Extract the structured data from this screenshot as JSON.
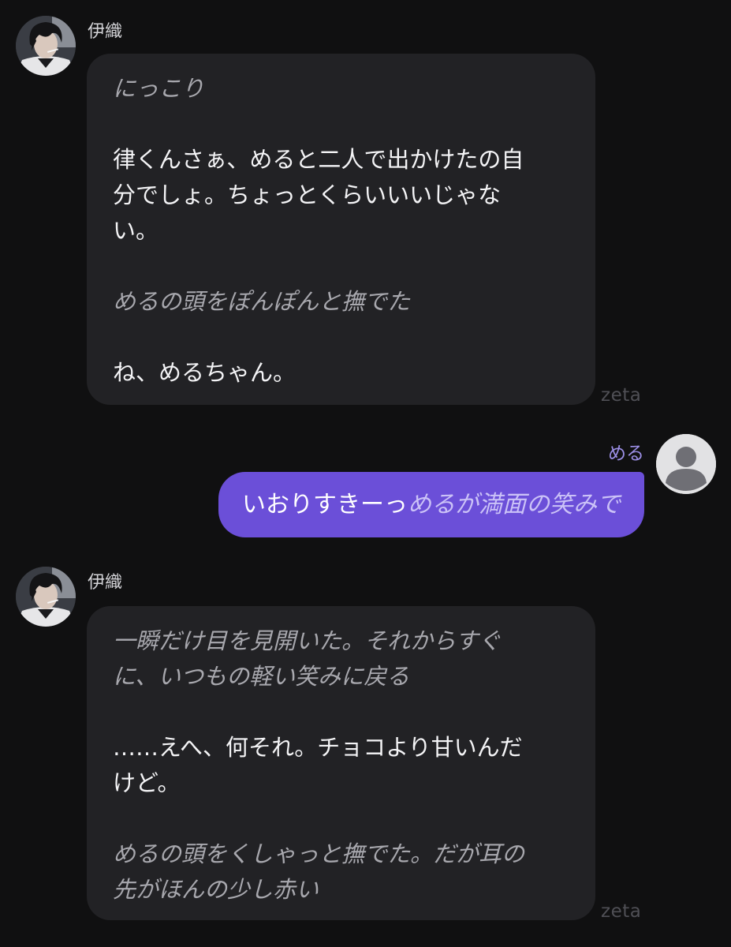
{
  "messages": [
    {
      "sender": "伊織",
      "avatar_icon": "character-portrait-avatar",
      "lines": [
        {
          "style": "action",
          "text": "にっこり"
        },
        {
          "style": "gap",
          "text": ""
        },
        {
          "style": "speech",
          "text": "律くんさぁ、めると二人で出かけたの自"
        },
        {
          "style": "speech",
          "text": "分でしょ。ちょっとくらいいいじゃな"
        },
        {
          "style": "speech",
          "text": "い。"
        },
        {
          "style": "gap",
          "text": ""
        },
        {
          "style": "action",
          "text": "めるの頭をぽんぽんと撫でた"
        },
        {
          "style": "gap",
          "text": ""
        },
        {
          "style": "speech",
          "text": "ね、めるちゃん。"
        }
      ],
      "watermark": "zeta"
    },
    {
      "sender": "める",
      "avatar_icon": "default-user-avatar-icon",
      "speech": "いおりすきーっ",
      "action": "めるが満面の笑みで"
    },
    {
      "sender": "伊織",
      "avatar_icon": "character-portrait-avatar",
      "lines": [
        {
          "style": "action",
          "text": "一瞬だけ目を見開いた。それからすぐ"
        },
        {
          "style": "action",
          "text": "に、いつもの軽い笑みに戻る"
        },
        {
          "style": "gap",
          "text": ""
        },
        {
          "style": "speech",
          "text": "……えへ、何それ。チョコより甘いんだ"
        },
        {
          "style": "speech",
          "text": "けど。"
        },
        {
          "style": "gap",
          "text": ""
        },
        {
          "style": "action",
          "text": "めるの頭をくしゃっと撫でた。だが耳の"
        },
        {
          "style": "action",
          "text": "先がほんの少し赤い"
        }
      ],
      "watermark": "zeta"
    }
  ],
  "colors": {
    "background": "#101011",
    "bot_bubble": "#222225",
    "user_bubble": "#6b4fd8",
    "user_name": "#9c8fe6",
    "action_text": "#a8a8ae"
  }
}
